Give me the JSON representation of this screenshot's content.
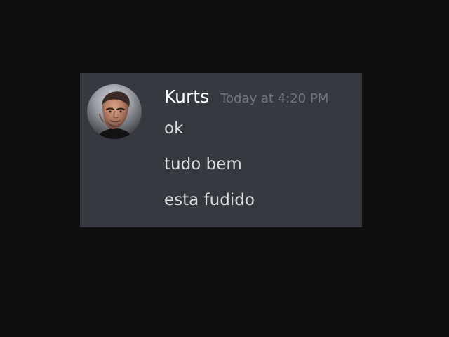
{
  "message": {
    "author": "Kurts",
    "timestamp": "Today at 4:20 PM",
    "lines": [
      "ok",
      "tudo bem",
      "esta fudido"
    ]
  },
  "colors": {
    "page_background": "#0f0f10",
    "card_background": "#36393f",
    "username": "#ffffff",
    "timestamp": "#72767d",
    "message_text": "#dcddde"
  },
  "icons": {
    "avatar": "user-avatar"
  }
}
